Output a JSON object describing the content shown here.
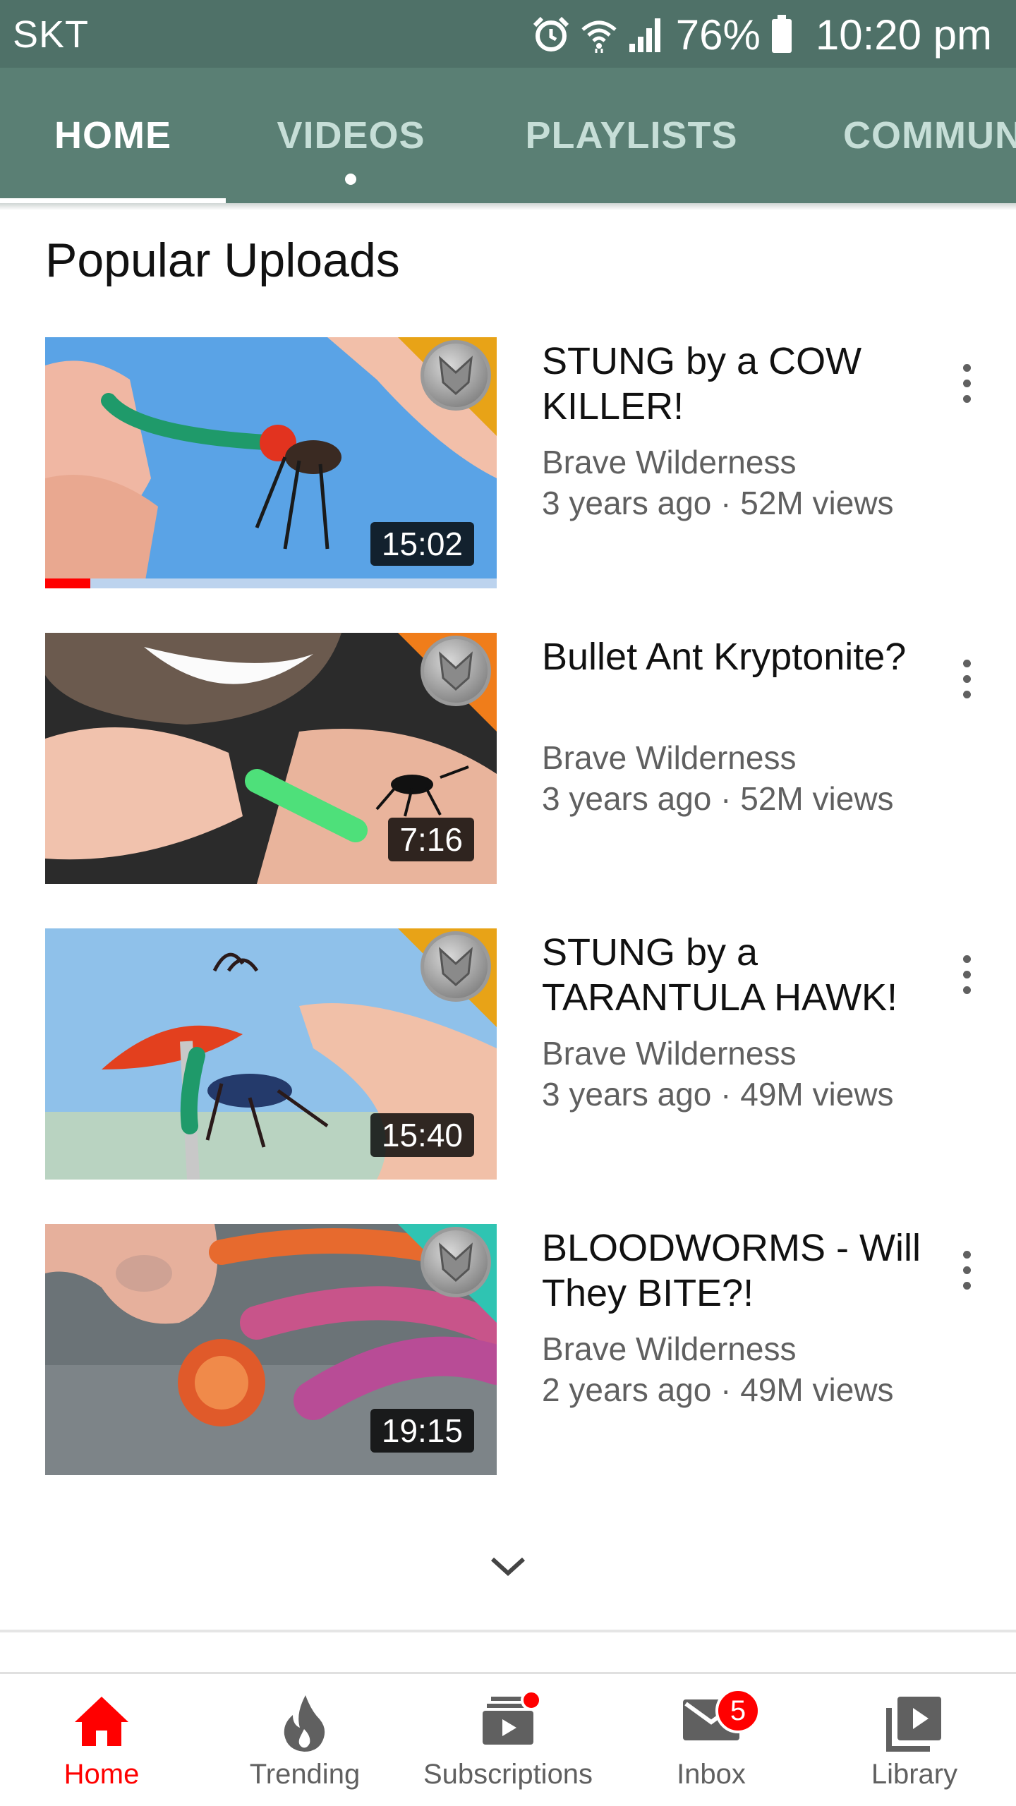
{
  "status_bar": {
    "carrier": "SKT",
    "battery_percent": "76%",
    "time": "10:20 pm",
    "icons": [
      "alarm-icon",
      "wifi-icon",
      "signal-icon",
      "battery-icon"
    ]
  },
  "channel_tabs": {
    "active": "HOME",
    "tabs": [
      {
        "label": "HOME"
      },
      {
        "label": "VIDEOS"
      },
      {
        "label": "PLAYLISTS"
      },
      {
        "label": "COMMUN"
      }
    ]
  },
  "section": {
    "title": "Popular Uploads"
  },
  "videos": [
    {
      "title": "STUNG by a COW KILLER!",
      "channel": "Brave Wilderness",
      "meta": "3 years ago · 52M views",
      "duration": "15:02",
      "watch_progress": 0.1,
      "corner_color": "#e8a317"
    },
    {
      "title": "Bullet Ant Kryptonite?",
      "channel": "Brave Wilderness",
      "meta": "3 years ago · 52M views",
      "duration": "7:16",
      "corner_color": "#f07d1a"
    },
    {
      "title": "STUNG by a TARANTULA HAWK!",
      "channel": "Brave Wilderness",
      "meta": "3 years ago · 49M views",
      "duration": "15:40",
      "corner_color": "#e8a317"
    },
    {
      "title": "BLOODWORMS - Will They BITE?!",
      "channel": "Brave Wilderness",
      "meta": "2 years ago · 49M views",
      "duration": "19:15",
      "corner_color": "#2fc4b2"
    }
  ],
  "bottom_nav": {
    "active": "Home",
    "items": [
      {
        "label": "Home",
        "icon": "home-icon"
      },
      {
        "label": "Trending",
        "icon": "flame-icon"
      },
      {
        "label": "Subscriptions",
        "icon": "subscriptions-icon"
      },
      {
        "label": "Inbox",
        "icon": "mail-icon",
        "badge": "5"
      },
      {
        "label": "Library",
        "icon": "library-icon"
      }
    ]
  },
  "colors": {
    "status_bar": "#4f7168",
    "tab_bar": "#5a7f74",
    "accent": "#ff0000"
  }
}
